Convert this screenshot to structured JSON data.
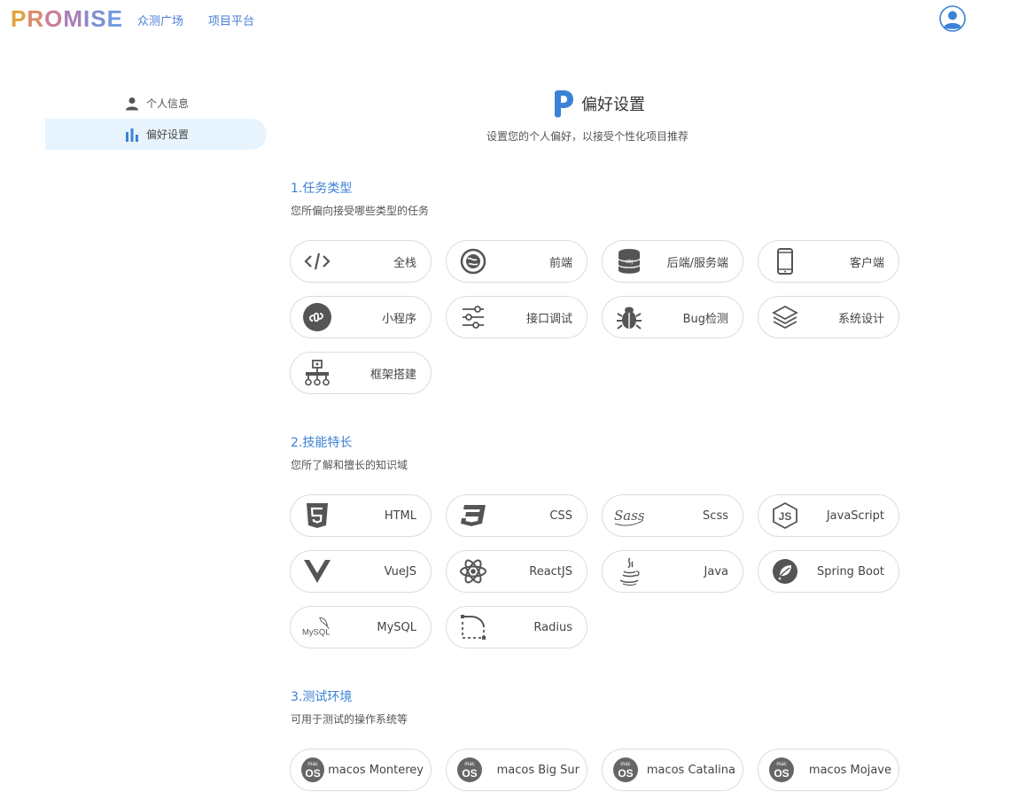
{
  "header": {
    "logo_letters": [
      "P",
      "R",
      "O",
      "M",
      "I",
      "S",
      "E"
    ],
    "logo_colors": [
      "#e0a23a",
      "#d98c6a",
      "#c77f9a",
      "#a97fb8",
      "#8f86cb",
      "#7f8fd3",
      "#6f9ae0"
    ],
    "nav": [
      "众测广场",
      "项目平台"
    ],
    "avatar_icon": "user-avatar-icon"
  },
  "sidebar": {
    "items": [
      {
        "label": "个人信息",
        "icon": "person-icon",
        "active": false
      },
      {
        "label": "偏好设置",
        "icon": "bar-chart-icon",
        "active": true
      }
    ]
  },
  "page": {
    "title": "偏好设置",
    "subtitle": "设置您的个人偏好，以接受个性化项目推荐"
  },
  "sections": [
    {
      "title": "1.任务类型",
      "desc": "您所偏向接受哪些类型的任务",
      "items": [
        {
          "label": "全栈",
          "icon": "code-icon"
        },
        {
          "label": "前端",
          "icon": "globe-icon"
        },
        {
          "label": "后端/服务端",
          "icon": "database-icon"
        },
        {
          "label": "客户端",
          "icon": "mobile-icon"
        },
        {
          "label": "小程序",
          "icon": "mini-program-icon"
        },
        {
          "label": "接口调试",
          "icon": "sliders-icon"
        },
        {
          "label": "Bug检测",
          "icon": "bug-icon"
        },
        {
          "label": "系统设计",
          "icon": "layers-icon"
        },
        {
          "label": "框架搭建",
          "icon": "hierarchy-icon"
        }
      ]
    },
    {
      "title": "2.技能特长",
      "desc": "您所了解和擅长的知识域",
      "items": [
        {
          "label": "HTML",
          "icon": "html5-icon"
        },
        {
          "label": "CSS",
          "icon": "css3-icon"
        },
        {
          "label": "Scss",
          "icon": "sass-icon"
        },
        {
          "label": "JavaScript",
          "icon": "js-icon"
        },
        {
          "label": "VueJS",
          "icon": "vue-icon"
        },
        {
          "label": "ReactJS",
          "icon": "react-icon"
        },
        {
          "label": "Java",
          "icon": "java-icon"
        },
        {
          "label": "Spring Boot",
          "icon": "spring-icon"
        },
        {
          "label": "MySQL",
          "icon": "mysql-icon"
        },
        {
          "label": "Radius",
          "icon": "radius-icon"
        }
      ]
    },
    {
      "title": "3.测试环境",
      "desc": "可用于测试的操作系统等",
      "items": [
        {
          "label": "macos Monterey",
          "icon": "macos-icon",
          "badge_top": "mac",
          "badge_main": "OS"
        },
        {
          "label": "macos Big Sur",
          "icon": "macos-icon",
          "badge_top": "mac",
          "badge_main": "OS"
        },
        {
          "label": "macos Catalina",
          "icon": "macos-icon",
          "badge_top": "mac",
          "badge_main": "OS"
        },
        {
          "label": "macos Mojave",
          "icon": "macos-icon",
          "badge_top": "mac",
          "badge_main": "OS"
        }
      ]
    }
  ],
  "colors": {
    "accent": "#3b82d6",
    "active_bg": "#e8f4fd",
    "chip_border": "#dcdcdc",
    "icon": "#555555"
  }
}
